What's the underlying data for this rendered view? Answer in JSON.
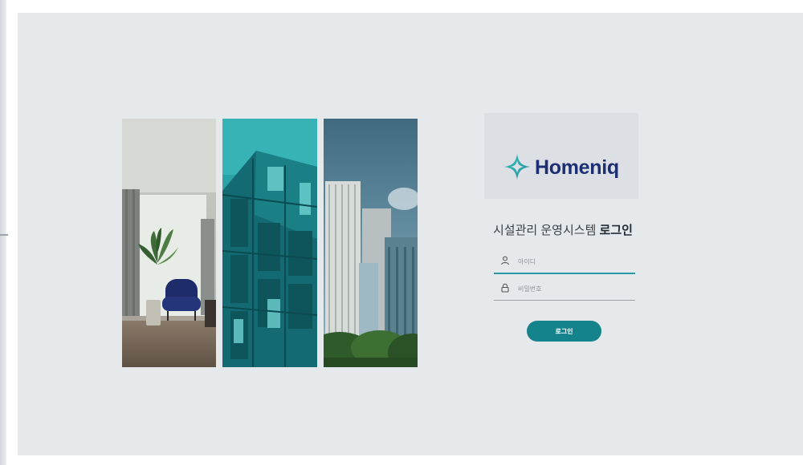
{
  "brand": {
    "name": "Homeniq",
    "accent": "#2aa3a0",
    "text_color": "#1d2f73"
  },
  "login": {
    "title_prefix": "시설관리 운영시스템",
    "title_emphasis": "로그인",
    "id_placeholder": "아이디",
    "password_placeholder": "비밀번호",
    "submit_label": "로그인",
    "button_color": "#14838c"
  },
  "images": [
    {
      "id": "interior",
      "subject": "living room with blue armchair and plant"
    },
    {
      "id": "facade",
      "subject": "teal glass building facade"
    },
    {
      "id": "skyline",
      "subject": "high-rise towers above green trees"
    }
  ]
}
